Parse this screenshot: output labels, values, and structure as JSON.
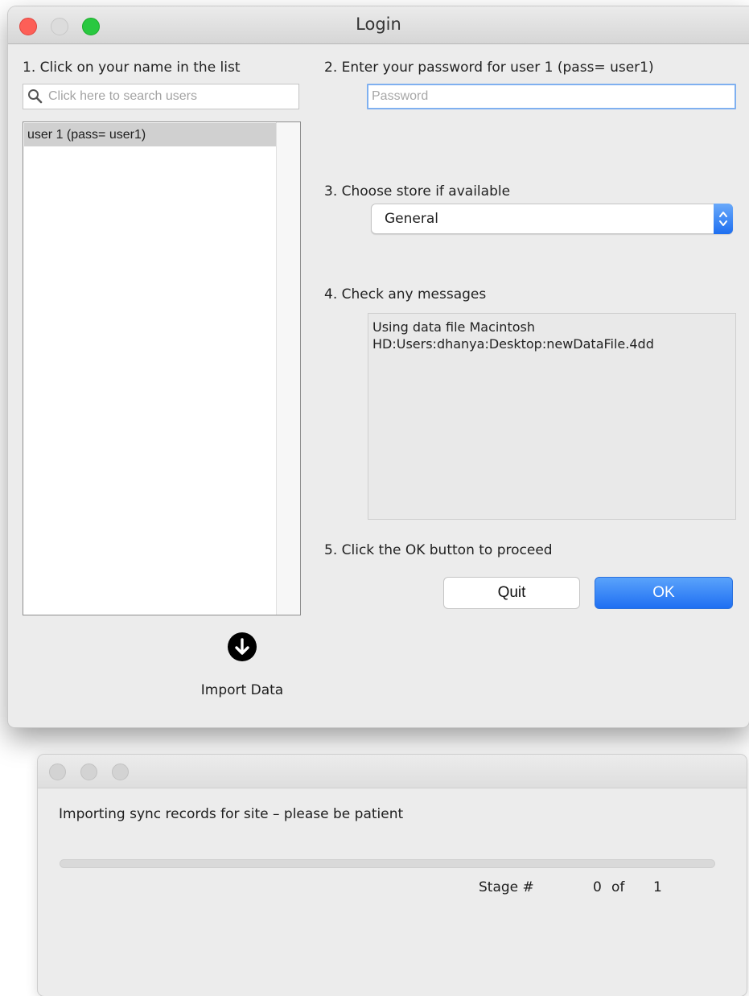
{
  "login_window": {
    "title": "Login",
    "step1_label": "1. Click on your name in the list",
    "search": {
      "placeholder": "Click here to search users",
      "value": ""
    },
    "users": [
      "user 1 (pass= user1)"
    ],
    "import_label": "Import Data",
    "step2_label": "2. Enter your password for user 1 (pass= user1)",
    "password": {
      "placeholder": "Password",
      "value": ""
    },
    "step3_label": "3. Choose store if available",
    "store_selected": "General",
    "step4_label": "4. Check any messages",
    "message": "Using data file Macintosh\nHD:Users:dhanya:Desktop:newDataFile.4dd",
    "step5_label": "5. Click the OK button to proceed",
    "quit_label": "Quit",
    "ok_label": "OK"
  },
  "import_window": {
    "message": "Importing sync records for site – please be patient",
    "progress": 0,
    "stage_label": "Stage #",
    "stage_current": "0",
    "stage_of": "of",
    "stage_total": "1"
  },
  "colors": {
    "accent": "#1f6ff2",
    "close": "#fd5f57",
    "zoom": "#29c840",
    "window_bg": "#ececec"
  },
  "icons": {
    "search": "magnifier-icon",
    "import": "arrow-down-circle-icon",
    "stepper": "chevron-up-down-icon"
  }
}
